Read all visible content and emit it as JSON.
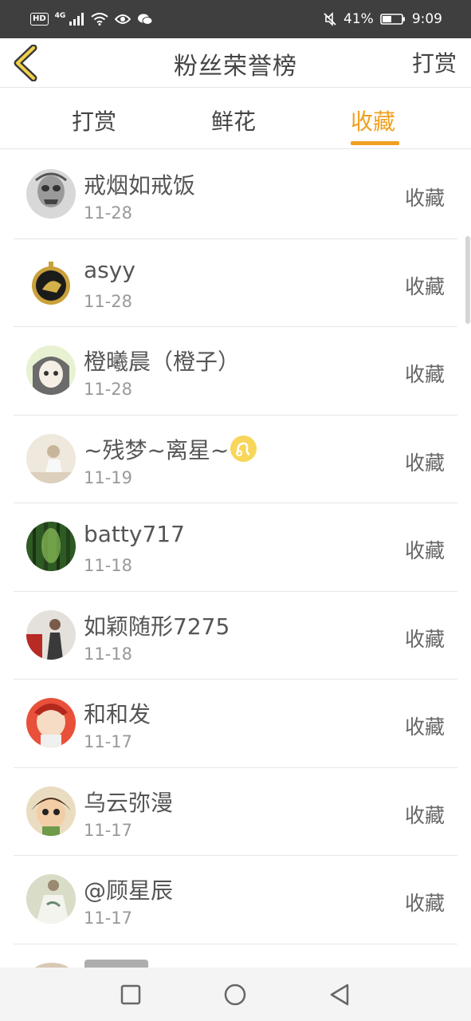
{
  "status_bar": {
    "left_badge": "HD",
    "network": "4G",
    "battery": "41%",
    "time": "9:09"
  },
  "header": {
    "title": "粉丝荣誉榜",
    "right_action": "打赏",
    "back_icon": "chevron-left-icon"
  },
  "tabs": [
    {
      "label": "打赏",
      "active": false
    },
    {
      "label": "鲜花",
      "active": false
    },
    {
      "label": "收藏",
      "active": true
    }
  ],
  "accent_color": "#f0a020",
  "rows": [
    {
      "name": "戒烟如戒饭",
      "date": "11-28",
      "action": "收藏"
    },
    {
      "name": "asyy",
      "date": "11-28",
      "action": "收藏"
    },
    {
      "name": "橙曦晨（橙子）",
      "date": "11-28",
      "action": "收藏"
    },
    {
      "name": "~残梦~离星~",
      "date": "11-19",
      "action": "收藏"
    },
    {
      "name": "batty717",
      "date": "11-18",
      "action": "收藏"
    },
    {
      "name": "如颖随形7275",
      "date": "11-18",
      "action": "收藏"
    },
    {
      "name": "和和发",
      "date": "11-17",
      "action": "收藏"
    },
    {
      "name": "乌云弥漫",
      "date": "11-17",
      "action": "收藏"
    },
    {
      "name": "@顾星辰",
      "date": "11-17",
      "action": "收藏"
    }
  ],
  "nav_bar": {
    "buttons": [
      "square-icon",
      "circle-icon",
      "triangle-back-icon"
    ]
  }
}
